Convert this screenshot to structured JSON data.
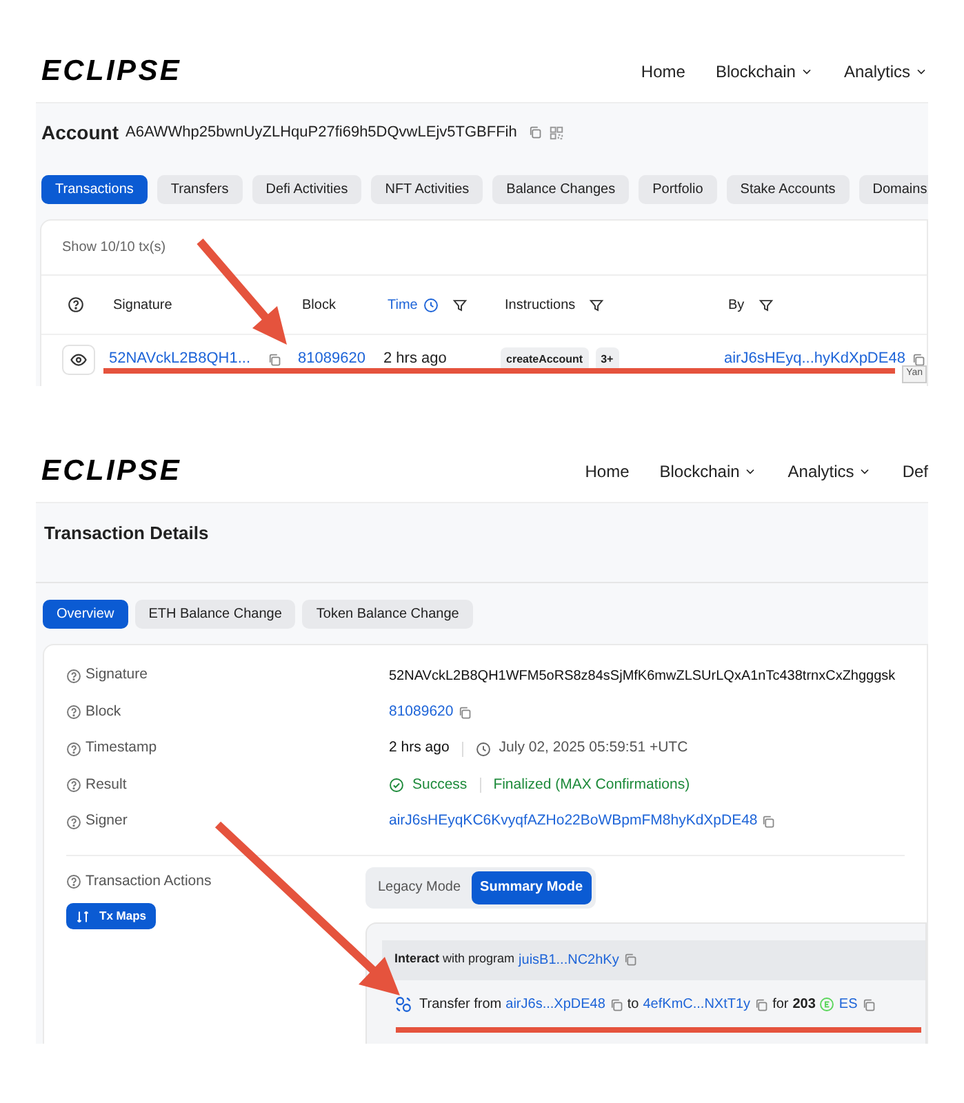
{
  "account_view": {
    "logo": "ECLIPSE",
    "nav": [
      {
        "label": "Home",
        "dropdown": false
      },
      {
        "label": "Blockchain",
        "dropdown": true
      },
      {
        "label": "Analytics",
        "dropdown": true
      }
    ],
    "title": "Account",
    "address": "A6AWWhp25bwnUyZLHquP27fi69h5DQvwLEjv5TGBFFih",
    "tabs": [
      {
        "label": "Transactions",
        "selected": true
      },
      {
        "label": "Transfers",
        "selected": false
      },
      {
        "label": "Defi Activities",
        "selected": false
      },
      {
        "label": "NFT Activities",
        "selected": false
      },
      {
        "label": "Balance Changes",
        "selected": false
      },
      {
        "label": "Portfolio",
        "selected": false
      },
      {
        "label": "Stake Accounts",
        "selected": false
      },
      {
        "label": "Domains",
        "selected": false
      }
    ],
    "count": "Show 10/10 tx(s)",
    "table": {
      "columns": [
        {
          "label": "Signature",
          "kind": "plain"
        },
        {
          "label": "Block",
          "kind": "plain"
        },
        {
          "label": "Time",
          "kind": "time"
        },
        {
          "label": "Instructions",
          "kind": "filter"
        },
        {
          "label": "By",
          "kind": "filter"
        }
      ],
      "rows": [
        {
          "signature": "52NAVckL2B8QH1...",
          "block": "81089620",
          "time": "2 hrs ago",
          "instruction": "createAccount",
          "more": "3+",
          "by": "airJ6sHEyq...hyKdXpDE48"
        }
      ]
    },
    "tooltip": "Yan"
  },
  "transaction_view": {
    "logo": "ECLIPSE",
    "nav": [
      {
        "label": "Home",
        "dropdown": false
      },
      {
        "label": "Blockchain",
        "dropdown": true
      },
      {
        "label": "Analytics",
        "dropdown": true
      },
      {
        "label": "Def",
        "dropdown": false
      }
    ],
    "title": "Transaction Details",
    "tabs": [
      {
        "label": "Overview",
        "selected": true
      },
      {
        "label": "ETH Balance Change",
        "selected": false
      },
      {
        "label": "Token Balance Change",
        "selected": false
      }
    ],
    "details": [
      {
        "label": "Signature",
        "kind": "text",
        "value": "52NAVckL2B8QH1WFM5oRS8z84sSjMfK6mwZLSUrLQxA1nTc438trnxCxZhgggsk"
      },
      {
        "label": "Block",
        "kind": "link",
        "value": "81089620"
      },
      {
        "label": "Timestamp",
        "kind": "time",
        "relative": "2 hrs ago",
        "absolute": "July 02, 2025 05:59:51 +UTC"
      },
      {
        "label": "Result",
        "kind": "status",
        "status": "Success",
        "finality": "Finalized (MAX Confirmations)"
      },
      {
        "label": "Signer",
        "kind": "link",
        "value": "airJ6sHEyqKC6KvyqfAZHo22BoWBpmFM8hyKdXpDE48"
      }
    ],
    "actions_label": "Transaction Actions",
    "tx_maps_button": "Tx Maps",
    "modes": [
      {
        "label": "Legacy Mode",
        "selected": false
      },
      {
        "label": "Summary Mode",
        "selected": true
      }
    ],
    "summary": {
      "interact": "**Interact** with program",
      "program": "juisB1...NC2hKy",
      "transfer_label": "Transfer from",
      "from": "airJ6s...XpDE48",
      "to_word": "to",
      "to": "4efKmC...NXtT1y",
      "for_word": "for",
      "amount": "203",
      "token": "ES"
    }
  }
}
